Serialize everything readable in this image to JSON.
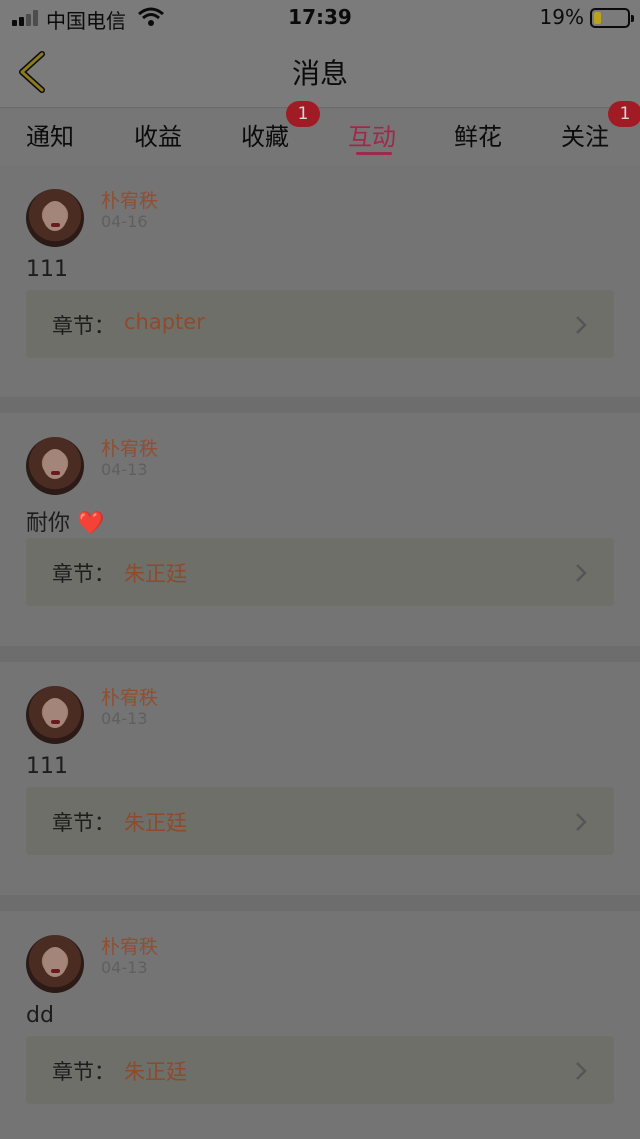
{
  "status_bar": {
    "carrier": "中国电信",
    "time": "17:39",
    "battery_percent": "19%",
    "battery_level": 0.19
  },
  "header": {
    "title": "消息",
    "back_icon": "chevron-left-icon"
  },
  "tabs": [
    {
      "label": "通知",
      "active": false
    },
    {
      "label": "收益",
      "active": false
    },
    {
      "label": "收藏",
      "active": false,
      "badge": "1"
    },
    {
      "label": "互动",
      "active": true
    },
    {
      "label": "鲜花",
      "active": false
    },
    {
      "label": "关注",
      "active": false,
      "badge": "1"
    }
  ],
  "messages": [
    {
      "username": "朴宥秩",
      "date": "04-16",
      "content": "111",
      "chapter_label": "章节：",
      "chapter": "chapter"
    },
    {
      "username": "朴宥秩",
      "date": "04-13",
      "content": "耐你",
      "emoji": "❤️",
      "chapter_label": "章节：",
      "chapter": "朱正廷"
    },
    {
      "username": "朴宥秩",
      "date": "04-13",
      "content": "111",
      "chapter_label": "章节：",
      "chapter": "朱正廷"
    },
    {
      "username": "朴宥秩",
      "date": "04-13",
      "content": "dd",
      "chapter_label": "章节：",
      "chapter": "朱正廷"
    }
  ],
  "colors": {
    "accent": "#9b2a4c",
    "badge": "#a11b24",
    "username": "#8f4f33",
    "chapter_value": "#8e4a2b"
  }
}
